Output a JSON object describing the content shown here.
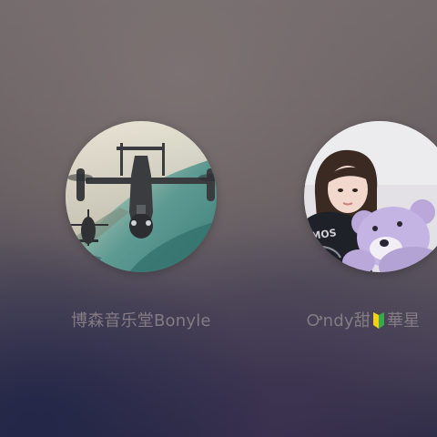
{
  "contacts": [
    {
      "name": "博森音乐堂Bonyle",
      "avatar_icon": "aircraft-photo-avatar"
    },
    {
      "name_prefix": "Ꭴndy甜",
      "badge_icon": "beginner-mark-icon",
      "name_suffix": "華星",
      "avatar_icon": "girl-with-teddy-bear-avatar"
    }
  ],
  "colors": {
    "name_text": "#87808a",
    "background_top": "#726a6b",
    "background_bottom": "#2c2b45"
  }
}
